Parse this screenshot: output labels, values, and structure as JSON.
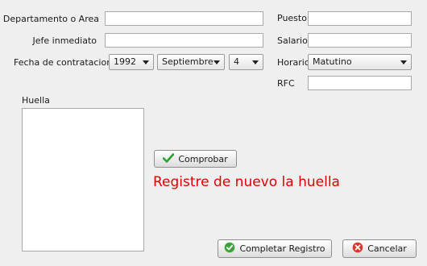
{
  "form": {
    "departamento_label": "Departamento o Area",
    "departamento_value": "",
    "jefe_label": "Jefe inmediato",
    "jefe_value": "",
    "fecha_label": "Fecha de contratacion",
    "fecha_year": "1992",
    "fecha_month": "Septiembre",
    "fecha_day": "4",
    "puesto_label": "Puesto",
    "puesto_value": "",
    "salario_label": "Salario",
    "salario_value": "",
    "horario_label": "Horario",
    "horario_value": "Matutino",
    "rfc_label": "RFC",
    "rfc_value": ""
  },
  "huella": {
    "label": "Huella",
    "comprobar_label": "Comprobar",
    "message": "Registre de nuevo la huella",
    "message_color": "#e00000"
  },
  "actions": {
    "completar_label": "Completar Registro",
    "cancelar_label": "Cancelar"
  },
  "icons": {
    "comprobar": "green-checkmark-icon",
    "completar": "green-circle-check-icon",
    "cancelar": "red-circle-x-icon"
  }
}
